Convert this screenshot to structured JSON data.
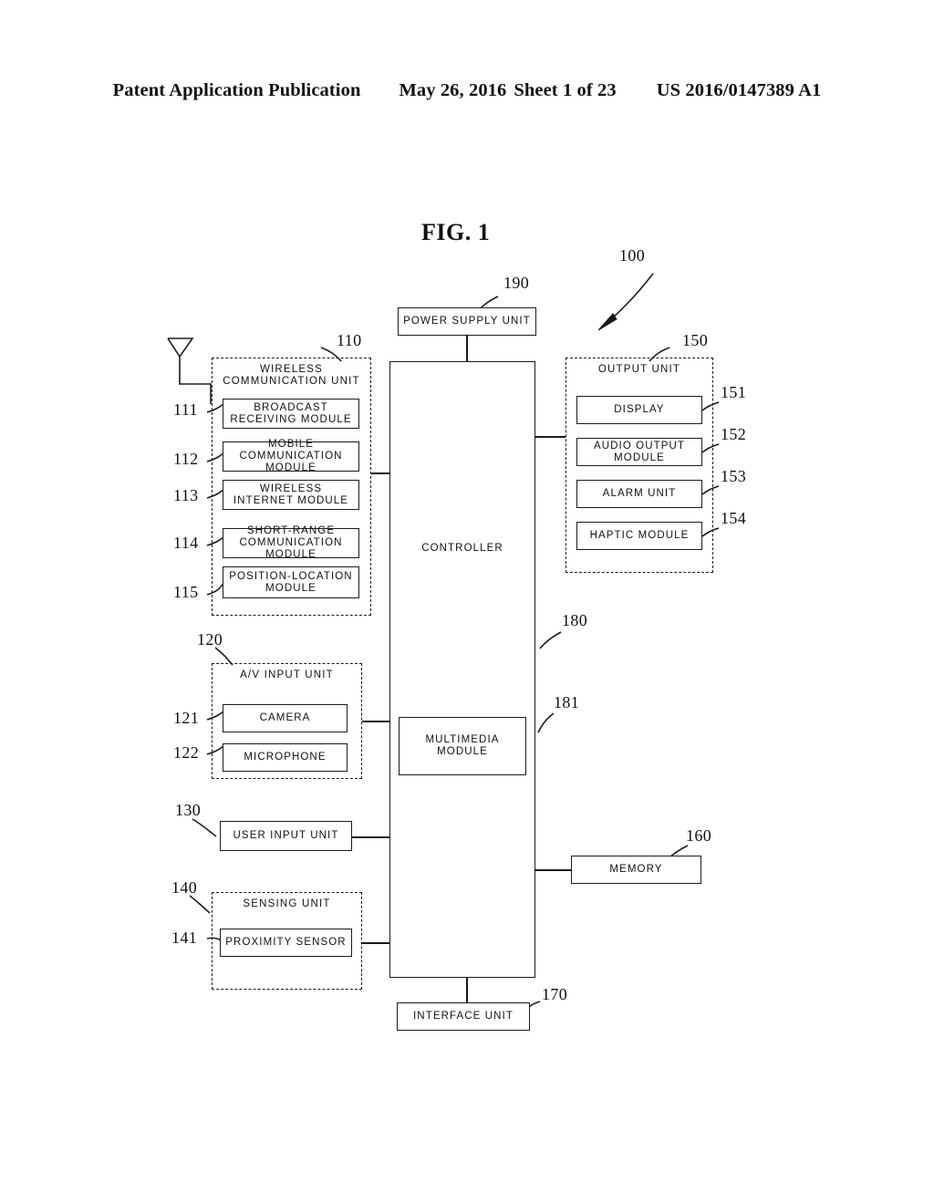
{
  "header": {
    "publication": "Patent Application Publication",
    "date": "May 26, 2016",
    "sheet": "Sheet 1 of 23",
    "number": "US 2016/0147389 A1"
  },
  "figure": {
    "title": "FIG. 1",
    "device_ref": "100"
  },
  "blocks": {
    "power_supply": {
      "label": "POWER SUPPLY UNIT",
      "ref": "190"
    },
    "controller": {
      "label": "CONTROLLER",
      "ref": "180"
    },
    "multimedia": {
      "label": "MULTIMEDIA MODULE",
      "ref": "181"
    },
    "memory": {
      "label": "MEMORY",
      "ref": "160"
    },
    "interface": {
      "label": "INTERFACE UNIT",
      "ref": "170"
    },
    "user_input": {
      "label": "USER INPUT UNIT",
      "ref": "130"
    }
  },
  "wireless_unit": {
    "title_line1": "WIRELESS",
    "title_line2": "COMMUNICATION UNIT",
    "ref": "110",
    "modules": [
      {
        "ref": "111",
        "line1": "BROADCAST",
        "line2": "RECEIVING MODULE"
      },
      {
        "ref": "112",
        "line1": "MOBILE",
        "line2": "COMMUNICATION MODULE"
      },
      {
        "ref": "113",
        "line1": "WIRELESS",
        "line2": "INTERNET MODULE"
      },
      {
        "ref": "114",
        "line1": "SHORT-RANGE",
        "line2": "COMMUNICATION MODULE"
      },
      {
        "ref": "115",
        "line1": "POSITION-LOCATION",
        "line2": "MODULE"
      }
    ]
  },
  "output_unit": {
    "title": "OUTPUT UNIT",
    "ref": "150",
    "modules": [
      {
        "ref": "151",
        "label": "DISPLAY"
      },
      {
        "ref": "152",
        "label": "AUDIO OUTPUT MODULE"
      },
      {
        "ref": "153",
        "label": "ALARM UNIT"
      },
      {
        "ref": "154",
        "label": "HAPTIC MODULE"
      }
    ]
  },
  "av_input_unit": {
    "title": "A/V INPUT UNIT",
    "ref": "120",
    "modules": [
      {
        "ref": "121",
        "label": "CAMERA"
      },
      {
        "ref": "122",
        "label": "MICROPHONE"
      }
    ]
  },
  "sensing_unit": {
    "title": "SENSING UNIT",
    "ref": "140",
    "modules": [
      {
        "ref": "141",
        "label": "PROXIMITY SENSOR"
      }
    ]
  },
  "icons": {
    "antenna": "antenna-icon",
    "device_arrow": "arrow-icon"
  }
}
